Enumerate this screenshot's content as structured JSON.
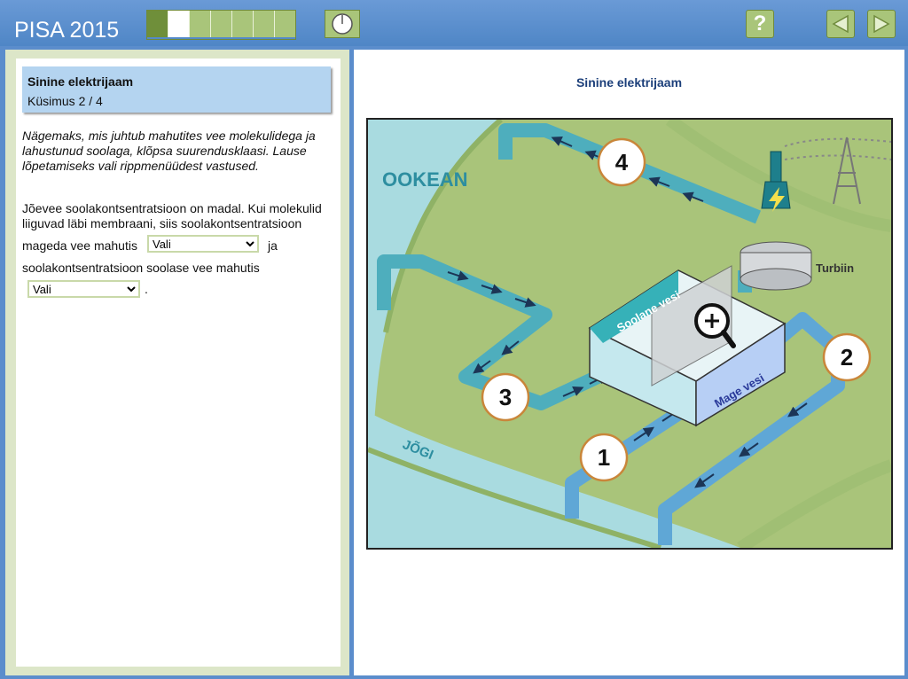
{
  "header": {
    "brand": "PISA 2015",
    "progress": [
      "done",
      "current",
      "todo",
      "todo",
      "todo",
      "todo",
      "todo"
    ],
    "help_label": "?"
  },
  "question": {
    "title": "Sinine elektrijaam",
    "number": "Küsimus 2 / 4",
    "instruction": "Nägemaks, mis juhtub mahutites vee molekulidega ja lahustunud soolaga, klõpsa suurendusklaasi. Lause lõpetamiseks vali rippmenüüdest vastused.",
    "line1": "Jõevee soolakontsentratsioon on madal. Kui molekulid",
    "line2": "liiguvad läbi membraani, siis soolakontsentratsioon",
    "line3_prefix": "mageda vee mahutis",
    "line3_suffix": "ja",
    "line4": "soolakontsentratsioon soolase vee mahutis",
    "period": ".",
    "dropdown1_value": "Vali",
    "dropdown2_value": "Vali"
  },
  "stimulus": {
    "title": "Sinine elektrijaam",
    "ocean_label": "OOKEAN",
    "river_label": "JÕGI",
    "salt_label": "Soolane vesi",
    "fresh_label": "Mage vesi",
    "turbine_label": "Turbiin",
    "pipe_labels": [
      "1",
      "2",
      "3",
      "4"
    ]
  }
}
